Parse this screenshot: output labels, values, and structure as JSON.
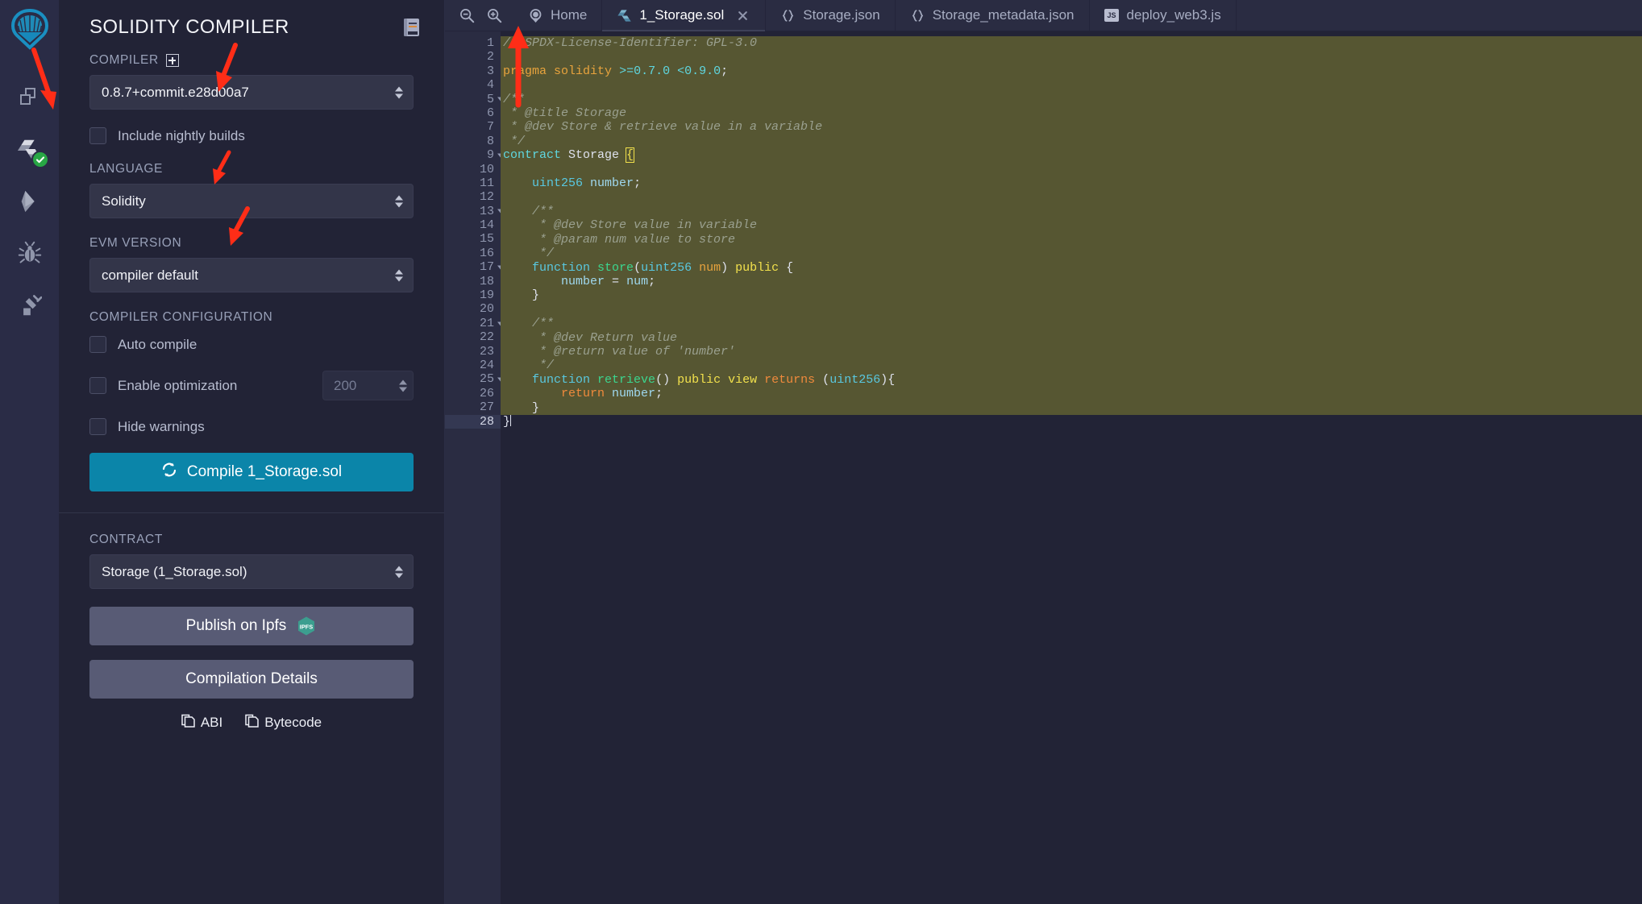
{
  "window": {
    "bg": "#222336",
    "accent": "#0b85a9",
    "annotation_color": "#ff2d17"
  },
  "rail": {
    "logo_name": "remix-logo",
    "items": [
      {
        "name": "file-explorer-icon",
        "label": "File explorers"
      },
      {
        "name": "solidity-compiler-icon",
        "label": "Solidity compiler",
        "badge": "check"
      },
      {
        "name": "deploy-run-transactions-icon",
        "label": "Deploy & run transactions"
      },
      {
        "name": "debugger-icon",
        "label": "Debugger"
      },
      {
        "name": "plugin-manager-icon",
        "label": "Plugin manager"
      }
    ]
  },
  "panel": {
    "title": "SOLIDITY COMPILER",
    "doc_icon": "book-icon",
    "compiler_label": "COMPILER",
    "compiler_add_icon": "plus-box-icon",
    "compiler_version": "0.8.7+commit.e28d00a7",
    "include_nightly_label": "Include nightly builds",
    "language_label": "LANGUAGE",
    "language_value": "Solidity",
    "evm_label": "EVM VERSION",
    "evm_value": "compiler default",
    "config_label": "COMPILER CONFIGURATION",
    "auto_compile_label": "Auto compile",
    "enable_optimization_label": "Enable optimization",
    "runs_value": "200",
    "hide_warnings_label": "Hide warnings",
    "compile_button_label": "Compile 1_Storage.sol",
    "compile_icon": "refresh-icon",
    "contract_label": "CONTRACT",
    "contract_value": "Storage (1_Storage.sol)",
    "publish_ipfs_label": "Publish on Ipfs",
    "ipfs_icon": "ipfs-hexagon-icon",
    "compilation_details_label": "Compilation Details",
    "abi_label": "ABI",
    "bytecode_label": "Bytecode",
    "copy_icon": "copy-icon"
  },
  "editor": {
    "zoom_out_icon": "zoom-out-icon",
    "zoom_in_icon": "zoom-in-icon",
    "tabs": [
      {
        "label": "Home",
        "icon": "remix-home-icon",
        "active": false,
        "closable": false
      },
      {
        "label": "1_Storage.sol",
        "icon": "solidity-file-icon",
        "active": true,
        "closable": true
      },
      {
        "label": "Storage.json",
        "icon": "json-braces-icon",
        "active": false,
        "closable": false
      },
      {
        "label": "Storage_metadata.json",
        "icon": "json-braces-icon",
        "active": false,
        "closable": false
      },
      {
        "label": "deploy_web3.js",
        "icon": "js-file-icon",
        "active": false,
        "closable": false
      }
    ],
    "current_line": 28,
    "total_lines": 28,
    "line_numbers": [
      1,
      2,
      3,
      4,
      5,
      6,
      7,
      8,
      9,
      10,
      11,
      12,
      13,
      14,
      15,
      16,
      17,
      18,
      19,
      20,
      21,
      22,
      23,
      24,
      25,
      26,
      27,
      28
    ],
    "fold_lines": [
      5,
      9,
      13,
      17,
      21,
      25
    ],
    "code_lines": [
      "// SPDX-License-Identifier: GPL-3.0",
      "",
      "pragma solidity >=0.7.0 <0.9.0;",
      "",
      "/**",
      " * @title Storage",
      " * @dev Store & retrieve value in a variable",
      " */",
      "contract Storage {",
      "",
      "    uint256 number;",
      "",
      "    /**",
      "     * @dev Store value in variable",
      "     * @param num value to store",
      "     */",
      "    function store(uint256 num) public {",
      "        number = num;",
      "    }",
      "",
      "    /**",
      "     * @dev Return value",
      "     * @return value of 'number'",
      "     */",
      "    function retrieve() public view returns (uint256){",
      "        return number;",
      "    }",
      "}"
    ]
  },
  "annotations": [
    {
      "name": "arrow-to-compiler-plugin-icon",
      "target": "rail solidity compiler icon"
    },
    {
      "name": "arrow-to-compiler-version-select",
      "target": "compiler version dropdown"
    },
    {
      "name": "arrow-to-language-select",
      "target": "language dropdown"
    },
    {
      "name": "arrow-to-evm-version-select",
      "target": "evm version dropdown"
    },
    {
      "name": "arrow-to-active-tab",
      "target": "1_Storage.sol tab"
    }
  ]
}
